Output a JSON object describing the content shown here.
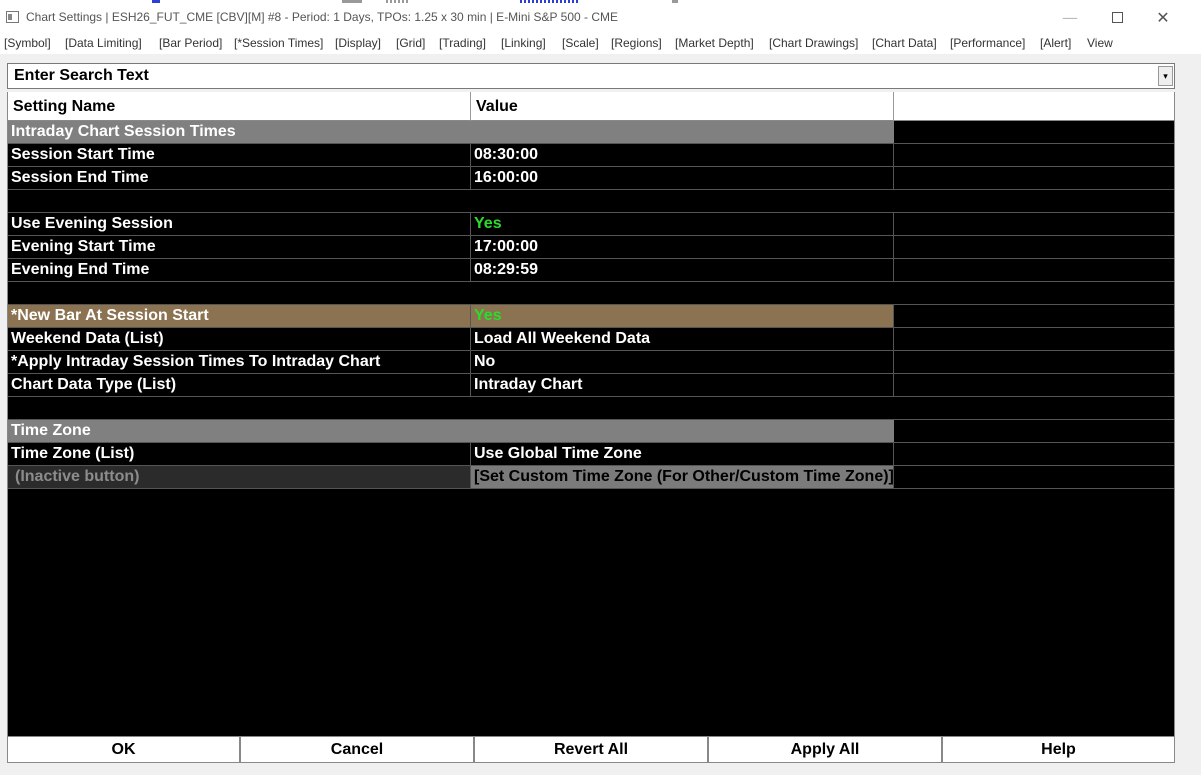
{
  "window": {
    "title": "Chart Settings | ESH26_FUT_CME [CBV][M] #8 - Period: 1 Days, TPOs: 1.25 x 30 min   | E-Mini S&P 500 - CME",
    "minimize_glyph": "—",
    "close_glyph": "✕"
  },
  "menu": {
    "items": [
      "[Symbol]",
      "[Data Limiting]",
      "[Bar Period]",
      "[*Session Times]",
      "[Display]",
      "[Grid]",
      "[Trading]",
      "[Linking]",
      "[Scale]",
      "[Regions]",
      "[Market Depth]",
      "[Chart Drawings]",
      "[Chart Data]",
      "[Performance]",
      "[Alert]",
      "View"
    ]
  },
  "search": {
    "placeholder": "Enter Search Text",
    "dropdown_glyph": "▾"
  },
  "table": {
    "headers": [
      "Setting Name",
      "Value",
      ""
    ],
    "rows": [
      {
        "type": "section",
        "name": "Intraday Chart Session Times"
      },
      {
        "type": "setting",
        "name": "Session Start Time",
        "value": "08:30:00"
      },
      {
        "type": "setting",
        "name": "Session End Time",
        "value": "16:00:00"
      },
      {
        "type": "blank"
      },
      {
        "type": "setting",
        "name": "Use Evening Session",
        "value": "Yes"
      },
      {
        "type": "setting",
        "name": "Evening Start Time",
        "value": "17:00:00"
      },
      {
        "type": "setting",
        "name": "Evening End Time",
        "value": "08:29:59"
      },
      {
        "type": "blank"
      },
      {
        "type": "setting",
        "name": "*New Bar At Session Start",
        "value": "Yes"
      },
      {
        "type": "setting",
        "name": "Weekend Data (List)",
        "value": "Load All Weekend Data"
      },
      {
        "type": "setting",
        "name": "*Apply Intraday Session Times To Intraday Chart",
        "value": "No"
      },
      {
        "type": "setting",
        "name": "Chart Data Type (List)",
        "value": "Intraday Chart"
      },
      {
        "type": "blank"
      },
      {
        "type": "section",
        "name": "Time Zone"
      },
      {
        "type": "setting",
        "name": "Time Zone (List)",
        "value": "Use Global Time Zone"
      },
      {
        "type": "setting",
        "name": "(Inactive button)",
        "value": "[Set Custom Time Zone (For Other/Custom Time Zone)]"
      }
    ]
  },
  "buttons": {
    "ok": "OK",
    "cancel": "Cancel",
    "revert_all": "Revert All",
    "apply_all": "Apply All",
    "help": "Help"
  },
  "colors": {
    "grid_bg": "#000000",
    "section_bg": "#808080",
    "highlight_bg": "#8b7250",
    "yes_green": "#2bdc2b"
  }
}
